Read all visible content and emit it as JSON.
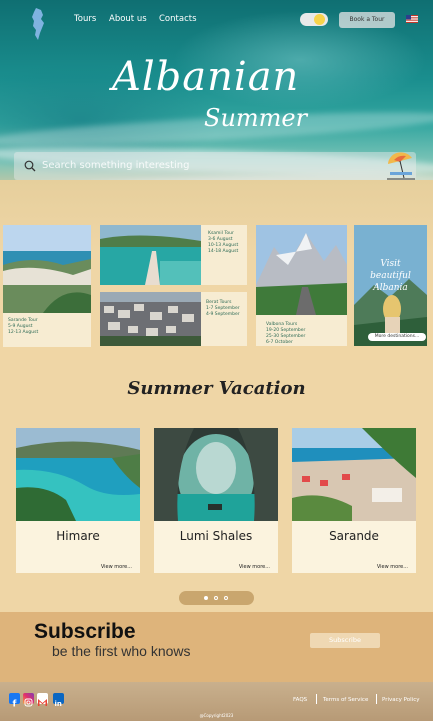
{
  "nav": {
    "links": [
      "Tours",
      "About us",
      "Contacts"
    ],
    "book_button": "Book a Tour"
  },
  "hero": {
    "title_line1": "Albanian",
    "title_line2": "Summer",
    "search_placeholder": "Search something interesting"
  },
  "tours": [
    {
      "text": "Sarande Tour\n5-9 August\n12-13 August"
    },
    {
      "text": "Ksamil Tour\n3-6 August\n10-13 August\n14-18 August"
    },
    {
      "text": "Berat Tours\n1-7 September\n4-9 September"
    },
    {
      "text": "Valbona Tours\n19-20 September\n25-30 September\n6-7 October"
    }
  ],
  "promo": {
    "text": "Visit\nbeautiful\nAlbania",
    "button": "More destinations..."
  },
  "section": {
    "title": "Summer  Vacation"
  },
  "destinations": [
    {
      "name": "Himare",
      "more": "View more..."
    },
    {
      "name": "Lumi Shales",
      "more": "View more..."
    },
    {
      "name": "Sarande",
      "more": "View more..."
    }
  ],
  "carousel": {
    "active_index": 0,
    "count": 3
  },
  "subscribe": {
    "heading": "Subscribe",
    "subheading": "be the first who knows",
    "button": "Subscribe"
  },
  "footer": {
    "links": [
      "FAQS",
      "Terms of Service",
      "Privacy Policy"
    ],
    "copyright": "@Copyright2023",
    "social_icons": [
      "facebook-icon",
      "instagram-icon",
      "gmail-icon",
      "linkedin-icon"
    ]
  },
  "colors": {
    "sand": "#efd6a6",
    "card": "#f7ecd2",
    "tour_text": "#2e6b56",
    "subscribe_bg": "#deb47b"
  }
}
